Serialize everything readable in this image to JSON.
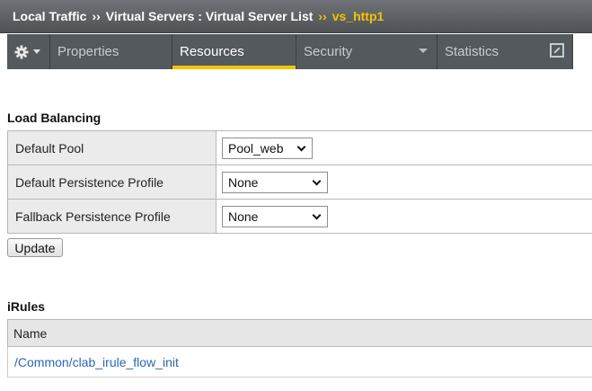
{
  "breadcrumb": {
    "items": [
      "Local Traffic",
      "Virtual Servers : Virtual Server List"
    ],
    "current": "vs_http1",
    "separator": "››"
  },
  "tabs": [
    {
      "label": "Properties",
      "active": false
    },
    {
      "label": "Resources",
      "active": true
    },
    {
      "label": "Security",
      "active": false,
      "has_dropdown": true
    },
    {
      "label": "Statistics",
      "active": false,
      "has_popout": true
    }
  ],
  "load_balancing": {
    "title": "Load Balancing",
    "rows": [
      {
        "label": "Default Pool",
        "value": "Pool_web"
      },
      {
        "label": "Default Persistence Profile",
        "value": "None"
      },
      {
        "label": "Fallback Persistence Profile",
        "value": "None"
      }
    ],
    "update_label": "Update"
  },
  "irules": {
    "title": "iRules",
    "column_header": "Name",
    "items": [
      "/Common/clab_irule_flow_init"
    ]
  },
  "colors": {
    "accent": "#f5c400",
    "tab_bg": "#54595d",
    "link": "#2a66b8"
  }
}
